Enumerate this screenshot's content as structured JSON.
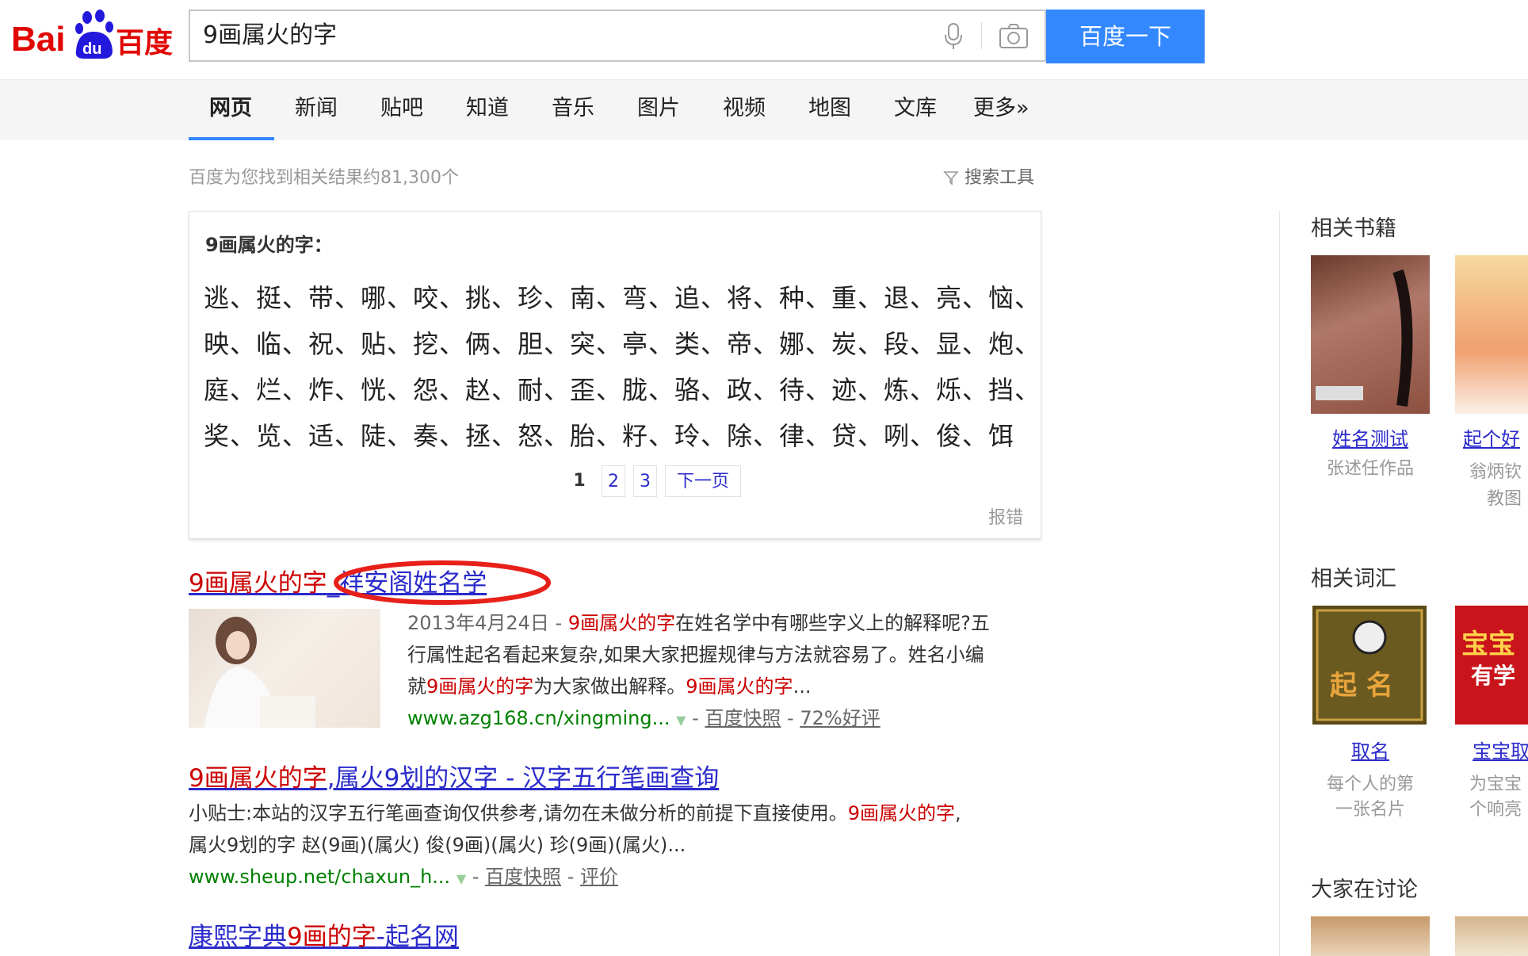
{
  "header": {
    "logo_text_left": "Bai",
    "logo_text_mid": "du",
    "logo_text_right": "百度",
    "query": "9画属火的字",
    "search_button": "百度一下"
  },
  "tabs": [
    "网页",
    "新闻",
    "贴吧",
    "知道",
    "音乐",
    "图片",
    "视频",
    "地图",
    "文库",
    "更多»"
  ],
  "results_info": {
    "count_text": "百度为您找到相关结果约81,300个",
    "tools_label": "搜索工具"
  },
  "answer_card": {
    "title": "9画属火的字：",
    "rows": [
      "逃、挺、带、哪、咬、挑、珍、南、弯、追、将、种、重、退、亮、恼、",
      "映、临、祝、贴、挖、俩、胆、突、亭、类、帝、娜、炭、段、显、炮、",
      "庭、烂、炸、恍、怨、赵、耐、歪、胧、骆、政、待、迹、炼、烁、挡、",
      "奖、览、适、陡、奏、拯、怒、胎、籽、玲、除、律、贷、咧、俊、饵"
    ],
    "pager": [
      "1",
      "2",
      "3",
      "下一页"
    ],
    "report": "报错"
  },
  "results": [
    {
      "title_em": "9画属火的字",
      "title_rest": "_祥安阁姓名学",
      "date": "2013年4月24日 - ",
      "line1_em": "9画属火的字",
      "line1_rest": "在姓名学中有哪些字义上的解释呢?五",
      "line2": "行属性起名看起来复杂,如果大家把握规律与方法就容易了。姓名小编",
      "line3_a": "就",
      "line3_em1": "9画属火的字",
      "line3_b": "为大家做出解释。",
      "line3_em2": "9画属火的字",
      "line3_c": "...",
      "url": "www.azg168.cn/xingming...",
      "cache": "百度快照",
      "rating": "72%好评"
    },
    {
      "title_em": "9画属火的字",
      "title_rest": ",属火9划的汉字 - 汉字五行笔画查询",
      "line1_a": "小贴士:本站的汉字五行笔画查询仅供参考,请勿在未做分析的前提下直接使用。",
      "line1_em": "9画属火的字",
      "line1_b": ",",
      "line2": "属火9划的字 赵(9画)(属火) 俊(9画)(属火) 珍(9画)(属火)...",
      "url": "www.sheup.net/chaxun_h...",
      "cache": "百度快照",
      "rating": "评价"
    },
    {
      "title_a": "康熙字典",
      "title_em": "9画的字",
      "title_b": "-起名网"
    }
  ],
  "sidebar": {
    "books_heading": "相关书籍",
    "books": [
      {
        "title": "姓名测试",
        "sub": "张述任作品"
      },
      {
        "title": "起个好",
        "sub": "翁炳钦"
      }
    ],
    "books_extra_sub": "教图",
    "words_heading": "相关词汇",
    "words": [
      {
        "title": "取名",
        "sub1": "每个人的第",
        "sub2": "一张名片"
      },
      {
        "title": "宝宝取",
        "sub1": "为宝宝",
        "sub2": "个响亮"
      }
    ],
    "discuss_heading": "大家在讨论"
  },
  "colors": {
    "accent": "#3388ff",
    "link": "#2a2acb",
    "em": "#cc0000",
    "url": "#008000"
  }
}
